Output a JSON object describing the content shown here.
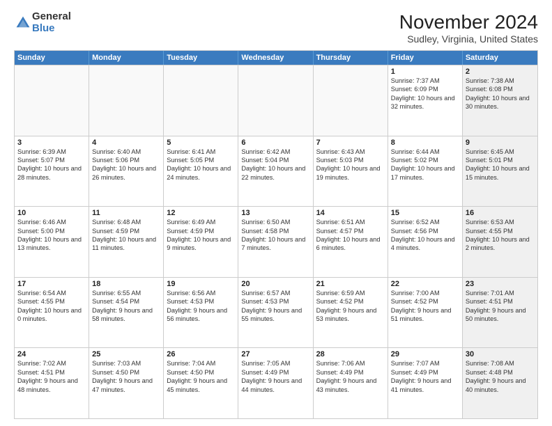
{
  "logo": {
    "general": "General",
    "blue": "Blue"
  },
  "title": "November 2024",
  "subtitle": "Sudley, Virginia, United States",
  "days_of_week": [
    "Sunday",
    "Monday",
    "Tuesday",
    "Wednesday",
    "Thursday",
    "Friday",
    "Saturday"
  ],
  "weeks": [
    [
      {
        "day": "",
        "text": "",
        "empty": true
      },
      {
        "day": "",
        "text": "",
        "empty": true
      },
      {
        "day": "",
        "text": "",
        "empty": true
      },
      {
        "day": "",
        "text": "",
        "empty": true
      },
      {
        "day": "",
        "text": "",
        "empty": true
      },
      {
        "day": "1",
        "text": "Sunrise: 7:37 AM\nSunset: 6:09 PM\nDaylight: 10 hours and 32 minutes."
      },
      {
        "day": "2",
        "text": "Sunrise: 7:38 AM\nSunset: 6:08 PM\nDaylight: 10 hours and 30 minutes."
      }
    ],
    [
      {
        "day": "3",
        "text": "Sunrise: 6:39 AM\nSunset: 5:07 PM\nDaylight: 10 hours and 28 minutes."
      },
      {
        "day": "4",
        "text": "Sunrise: 6:40 AM\nSunset: 5:06 PM\nDaylight: 10 hours and 26 minutes."
      },
      {
        "day": "5",
        "text": "Sunrise: 6:41 AM\nSunset: 5:05 PM\nDaylight: 10 hours and 24 minutes."
      },
      {
        "day": "6",
        "text": "Sunrise: 6:42 AM\nSunset: 5:04 PM\nDaylight: 10 hours and 22 minutes."
      },
      {
        "day": "7",
        "text": "Sunrise: 6:43 AM\nSunset: 5:03 PM\nDaylight: 10 hours and 19 minutes."
      },
      {
        "day": "8",
        "text": "Sunrise: 6:44 AM\nSunset: 5:02 PM\nDaylight: 10 hours and 17 minutes."
      },
      {
        "day": "9",
        "text": "Sunrise: 6:45 AM\nSunset: 5:01 PM\nDaylight: 10 hours and 15 minutes."
      }
    ],
    [
      {
        "day": "10",
        "text": "Sunrise: 6:46 AM\nSunset: 5:00 PM\nDaylight: 10 hours and 13 minutes."
      },
      {
        "day": "11",
        "text": "Sunrise: 6:48 AM\nSunset: 4:59 PM\nDaylight: 10 hours and 11 minutes."
      },
      {
        "day": "12",
        "text": "Sunrise: 6:49 AM\nSunset: 4:59 PM\nDaylight: 10 hours and 9 minutes."
      },
      {
        "day": "13",
        "text": "Sunrise: 6:50 AM\nSunset: 4:58 PM\nDaylight: 10 hours and 7 minutes."
      },
      {
        "day": "14",
        "text": "Sunrise: 6:51 AM\nSunset: 4:57 PM\nDaylight: 10 hours and 6 minutes."
      },
      {
        "day": "15",
        "text": "Sunrise: 6:52 AM\nSunset: 4:56 PM\nDaylight: 10 hours and 4 minutes."
      },
      {
        "day": "16",
        "text": "Sunrise: 6:53 AM\nSunset: 4:55 PM\nDaylight: 10 hours and 2 minutes."
      }
    ],
    [
      {
        "day": "17",
        "text": "Sunrise: 6:54 AM\nSunset: 4:55 PM\nDaylight: 10 hours and 0 minutes."
      },
      {
        "day": "18",
        "text": "Sunrise: 6:55 AM\nSunset: 4:54 PM\nDaylight: 9 hours and 58 minutes."
      },
      {
        "day": "19",
        "text": "Sunrise: 6:56 AM\nSunset: 4:53 PM\nDaylight: 9 hours and 56 minutes."
      },
      {
        "day": "20",
        "text": "Sunrise: 6:57 AM\nSunset: 4:53 PM\nDaylight: 9 hours and 55 minutes."
      },
      {
        "day": "21",
        "text": "Sunrise: 6:59 AM\nSunset: 4:52 PM\nDaylight: 9 hours and 53 minutes."
      },
      {
        "day": "22",
        "text": "Sunrise: 7:00 AM\nSunset: 4:52 PM\nDaylight: 9 hours and 51 minutes."
      },
      {
        "day": "23",
        "text": "Sunrise: 7:01 AM\nSunset: 4:51 PM\nDaylight: 9 hours and 50 minutes."
      }
    ],
    [
      {
        "day": "24",
        "text": "Sunrise: 7:02 AM\nSunset: 4:51 PM\nDaylight: 9 hours and 48 minutes."
      },
      {
        "day": "25",
        "text": "Sunrise: 7:03 AM\nSunset: 4:50 PM\nDaylight: 9 hours and 47 minutes."
      },
      {
        "day": "26",
        "text": "Sunrise: 7:04 AM\nSunset: 4:50 PM\nDaylight: 9 hours and 45 minutes."
      },
      {
        "day": "27",
        "text": "Sunrise: 7:05 AM\nSunset: 4:49 PM\nDaylight: 9 hours and 44 minutes."
      },
      {
        "day": "28",
        "text": "Sunrise: 7:06 AM\nSunset: 4:49 PM\nDaylight: 9 hours and 43 minutes."
      },
      {
        "day": "29",
        "text": "Sunrise: 7:07 AM\nSunset: 4:49 PM\nDaylight: 9 hours and 41 minutes."
      },
      {
        "day": "30",
        "text": "Sunrise: 7:08 AM\nSunset: 4:48 PM\nDaylight: 9 hours and 40 minutes."
      }
    ]
  ]
}
